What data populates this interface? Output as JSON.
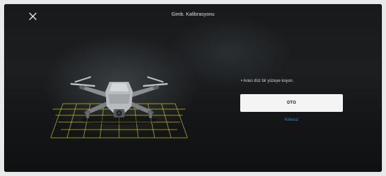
{
  "header": {
    "title": "Gimb. Kalibrasyonu"
  },
  "close": {
    "icon": "close-icon"
  },
  "illustration": {
    "icon": "drone-icon",
    "grid_color": "#d8cf2a"
  },
  "panel": {
    "instruction": "• Aracı düz bir yüzeye koyun.",
    "auto_button_label": "OTO",
    "guide_link_label": "Kılavuz"
  },
  "colors": {
    "background": "#111214",
    "button_bg": "#f4f4f4",
    "link": "#3a8bd6"
  }
}
